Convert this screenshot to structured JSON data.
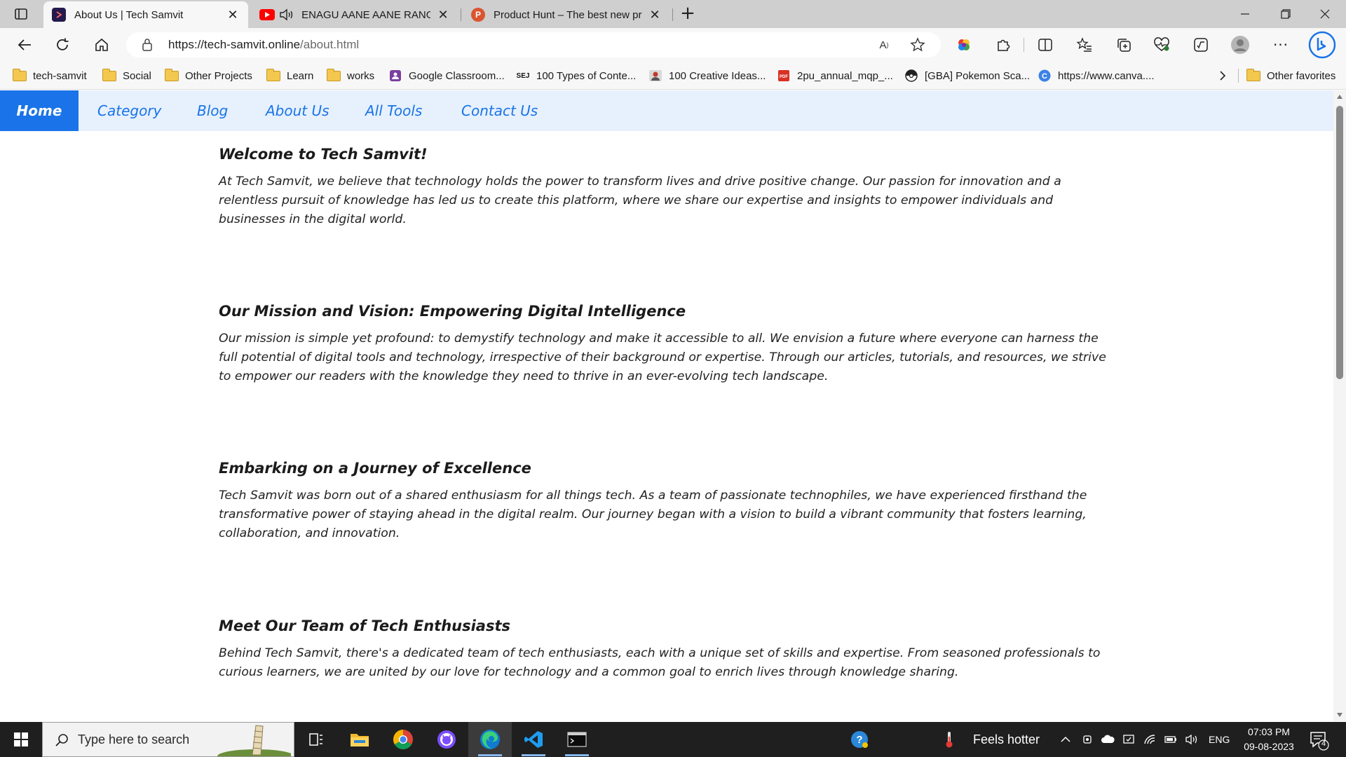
{
  "browser": {
    "tabs": [
      {
        "title": "About Us | Tech Samvit",
        "active": true
      },
      {
        "title": "ENAGU AANE AANE RANGA",
        "active": false
      },
      {
        "title": "Product Hunt – The best new pro",
        "active": false
      }
    ],
    "address": {
      "host": "https://tech-samvit.online",
      "path": "/about.html"
    },
    "favorites": [
      {
        "label": "tech-samvit",
        "icon": "folder-icon"
      },
      {
        "label": "Social",
        "icon": "folder-icon"
      },
      {
        "label": "Other Projects",
        "icon": "folder-icon"
      },
      {
        "label": "Learn",
        "icon": "folder-icon"
      },
      {
        "label": "works",
        "icon": "folder-icon"
      },
      {
        "label": "Google Classroom...",
        "icon": "classroom-icon"
      },
      {
        "label": "100 Types of Conte...",
        "icon": "sej-icon"
      },
      {
        "label": "100 Creative Ideas...",
        "icon": "profile-icon"
      },
      {
        "label": "2pu_annual_mqp_...",
        "icon": "pdf-icon"
      },
      {
        "label": "[GBA] Pokemon Sca...",
        "icon": "pokeball-icon"
      },
      {
        "label": "https://www.canva....",
        "icon": "canva-icon"
      }
    ],
    "other_favorites": "Other favorites",
    "colors": {
      "accent": "#1a73e8",
      "tab_strip": "#cfcfcf",
      "toolbar": "#f7f7f7"
    }
  },
  "site": {
    "nav": [
      {
        "label": "Home",
        "active": true
      },
      {
        "label": "Category",
        "active": false
      },
      {
        "label": "Blog",
        "active": false
      },
      {
        "label": "About Us",
        "active": false
      },
      {
        "label": "All Tools",
        "active": false
      },
      {
        "label": "Contact Us",
        "active": false
      }
    ],
    "sections": [
      {
        "heading": "Welcome to Tech Samvit!",
        "body": "At Tech Samvit, we believe that technology holds the power to transform lives and drive positive change. Our passion for innovation and a relentless pursuit of knowledge has led us to create this platform, where we share our expertise and insights to empower individuals and businesses in the digital world."
      },
      {
        "heading": "Our Mission and Vision: Empowering Digital Intelligence",
        "body": "Our mission is simple yet profound: to demystify technology and make it accessible to all. We envision a future where everyone can harness the full potential of digital tools and technology, irrespective of their background or expertise. Through our articles, tutorials, and resources, we strive to empower our readers with the knowledge they need to thrive in an ever-evolving tech landscape."
      },
      {
        "heading": "Embarking on a Journey of Excellence",
        "body": "Tech Samvit was born out of a shared enthusiasm for all things tech. As a team of passionate technophiles, we have experienced firsthand the transformative power of staying ahead in the digital realm. Our journey began with a vision to build a vibrant community that fosters learning, collaboration, and innovation."
      },
      {
        "heading": "Meet Our Team of Tech Enthusiasts",
        "body": "Behind Tech Samvit, there's a dedicated team of tech enthusiasts, each with a unique set of skills and expertise. From seasoned professionals to curious learners, we are united by our love for technology and a common goal to enrich lives through knowledge sharing."
      }
    ]
  },
  "taskbar": {
    "search_placeholder": "Type here to search",
    "weather": "Feels hotter",
    "language": "ENG",
    "time": "07:03 PM",
    "date": "09-08-2023",
    "notifications": "4"
  }
}
